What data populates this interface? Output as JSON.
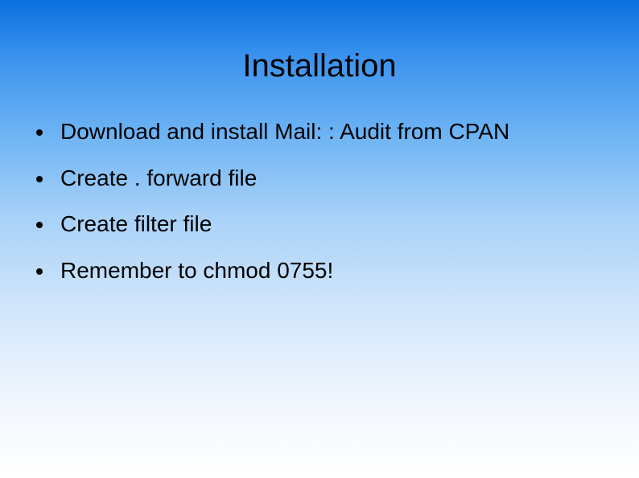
{
  "title": "Installation",
  "bullets": [
    "Download and install Mail: : Audit from CPAN",
    "Create . forward file",
    "Create filter file",
    "Remember to chmod 0755!"
  ]
}
